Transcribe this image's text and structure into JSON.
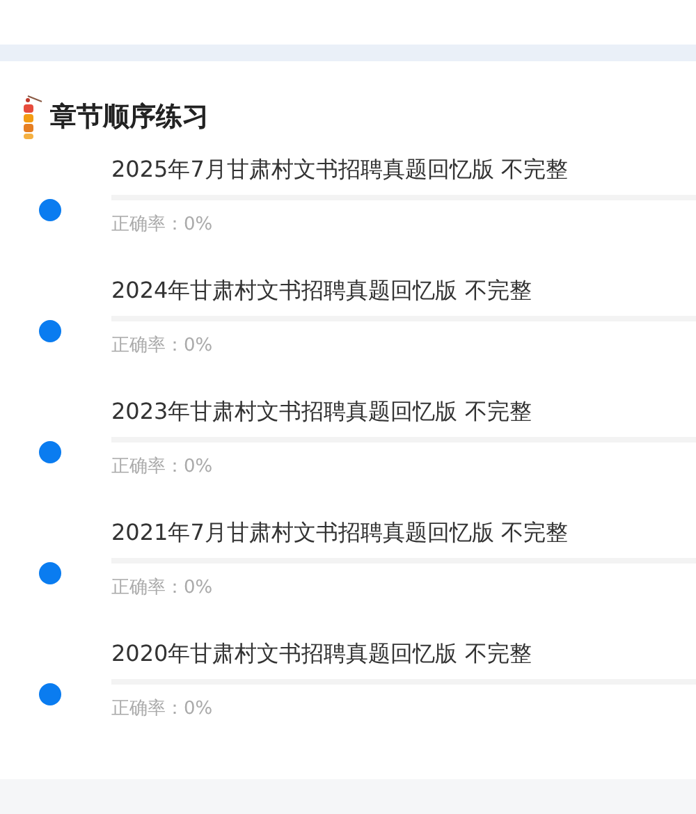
{
  "section": {
    "title": "章节顺序练习"
  },
  "chapters": [
    {
      "title": "2025年7月甘肃村文书招聘真题回忆版 不完整",
      "level": 0,
      "accuracy": "正确率：0%"
    },
    {
      "title": "2024年甘肃村文书招聘真题回忆版 不完整",
      "level": 0,
      "accuracy": "正确率：0%"
    },
    {
      "title": "2023年甘肃村文书招聘真题回忆版 不完整",
      "level": 0,
      "accuracy": "正确率：0%"
    },
    {
      "title": "2021年7月甘肃村文书招聘真题回忆版 不完整",
      "level": 0,
      "accuracy": "正确率：0%"
    },
    {
      "title": "2020年甘肃村文书招聘真题回忆版 不完整",
      "level": 0,
      "accuracy": "正确率：0%"
    }
  ]
}
